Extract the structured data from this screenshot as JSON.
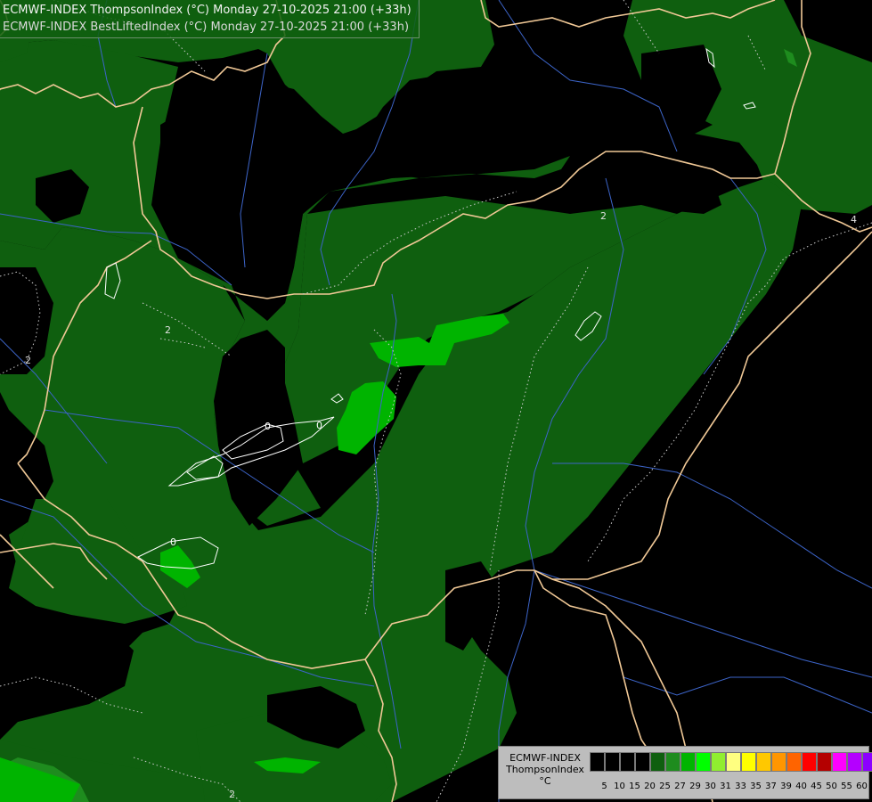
{
  "titles": {
    "line1": "ECMWF-INDEX ThompsonIndex (°C) Monday 27-10-2025 21:00 (+33h)",
    "line2": "ECMWF-INDEX BestLiftedIndex (°C) Monday 27-10-2025 21:00 (+33h)"
  },
  "colors": {
    "background": "#000000",
    "level_20_25": "#0f5f0f",
    "level_25_27": "#1e8c1e",
    "level_27_29": "#00b400",
    "border": "#f0c896",
    "river": "#3c64c8",
    "contour_dotted": "#cccccc",
    "contour_solid": "#ffffff"
  },
  "legend": {
    "label_lines": [
      "ECMWF-INDEX",
      "ThompsonIndex",
      "°C"
    ],
    "swatch_colors": [
      "#000000",
      "#000000",
      "#000000",
      "#000000",
      "#0f5f0f",
      "#1e8c1e",
      "#00b400",
      "#00ff00",
      "#90ee30",
      "#ffff80",
      "#ffff00",
      "#ffc800",
      "#ff9600",
      "#ff6400",
      "#ff0000",
      "#b40000",
      "#ff00ff",
      "#b400ff",
      "#8c00ff",
      "#6400ff",
      "#0000ff"
    ],
    "ticks": [
      "5",
      "10",
      "15",
      "20",
      "25",
      "27",
      "29",
      "30",
      "31",
      "33",
      "35",
      "37",
      "39",
      "40",
      "45",
      "50",
      "55",
      "60"
    ]
  },
  "contour_labels": [
    {
      "text": "2"
    },
    {
      "text": "2"
    },
    {
      "text": "2"
    },
    {
      "text": "0"
    },
    {
      "text": "0"
    },
    {
      "text": "0"
    },
    {
      "text": "2"
    },
    {
      "text": "4"
    }
  ]
}
